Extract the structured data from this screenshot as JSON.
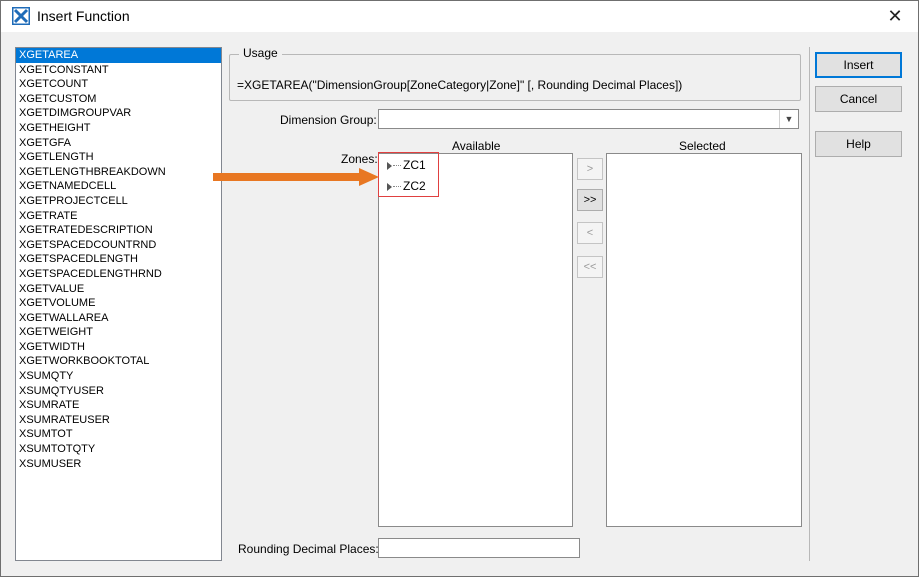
{
  "window": {
    "title": "Insert Function",
    "close_glyph": "✕",
    "icon": "excel-x-icon"
  },
  "functions": [
    "XGETAREA",
    "XGETCONSTANT",
    "XGETCOUNT",
    "XGETCUSTOM",
    "XGETDIMGROUPVAR",
    "XGETHEIGHT",
    "XGETGFA",
    "XGETLENGTH",
    "XGETLENGTHBREAKDOWN",
    "XGETNAMEDCELL",
    "XGETPROJECTCELL",
    "XGETRATE",
    "XGETRATEDESCRIPTION",
    "XGETSPACEDCOUNTRND",
    "XGETSPACEDLENGTH",
    "XGETSPACEDLENGTHRND",
    "XGETVALUE",
    "XGETVOLUME",
    "XGETWALLAREA",
    "XGETWEIGHT",
    "XGETWIDTH",
    "XGETWORKBOOKTOTAL",
    "XSUMQTY",
    "XSUMQTYUSER",
    "XSUMRATE",
    "XSUMRATEUSER",
    "XSUMTOT",
    "XSUMTOTQTY",
    "XSUMUSER"
  ],
  "selected_function": "XGETAREA",
  "usage": {
    "legend": "Usage",
    "text": "=XGETAREA(\"DimensionGroup[ZoneCategory|Zone]\" [, Rounding Decimal Places])"
  },
  "dimension_group": {
    "label": "Dimension Group:",
    "value": "",
    "arrow_glyph": "▼"
  },
  "zones": {
    "label": "Zones:",
    "available_header": "Available",
    "selected_header": "Selected",
    "available_items": [
      "ZC1",
      "ZC2"
    ],
    "selected_items": []
  },
  "move_buttons": {
    "add": ">",
    "add_all": ">>",
    "remove": "<",
    "remove_all": "<<"
  },
  "rounding": {
    "label": "Rounding Decimal Places:",
    "value": ""
  },
  "buttons": {
    "insert": "Insert",
    "cancel": "Cancel",
    "help": "Help"
  },
  "colors": {
    "selection": "#0078d7",
    "highlight_box": "#e04040",
    "annotation_arrow": "#e87722"
  }
}
